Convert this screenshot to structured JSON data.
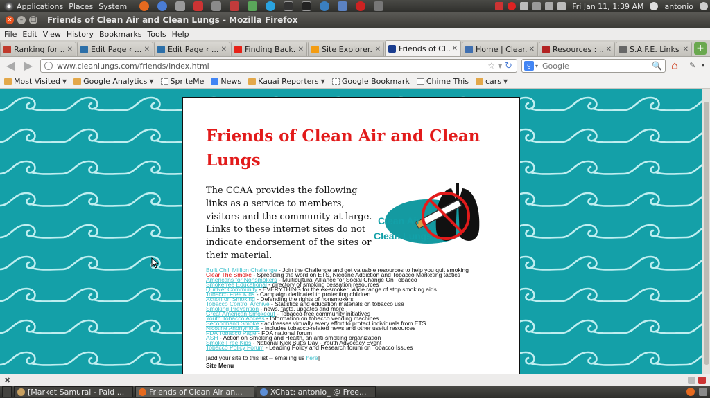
{
  "top_panel": {
    "menus": [
      "Applications",
      "Places",
      "System"
    ],
    "clock": "Fri Jan 11,  1:39 AM",
    "user": "antonio"
  },
  "window": {
    "title": "Friends of Clean Air and Clean Lungs - Mozilla Firefox"
  },
  "menu_bar": [
    "File",
    "Edit",
    "View",
    "History",
    "Bookmarks",
    "Tools",
    "Help"
  ],
  "tabs": [
    {
      "label": "Ranking for ...",
      "favicon_color": "#c0392b",
      "active": false
    },
    {
      "label": "Edit Page ‹ ...",
      "favicon_color": "#2c6fa8",
      "active": false
    },
    {
      "label": "Edit Page ‹ ...",
      "favicon_color": "#2c6fa8",
      "active": false
    },
    {
      "label": "Finding Back...",
      "favicon_color": "#e62117",
      "active": false
    },
    {
      "label": "Site Explorer...",
      "favicon_color": "#f39c12",
      "active": false
    },
    {
      "label": "Friends of Cl...",
      "favicon_color": "#1a3d8f",
      "active": true
    },
    {
      "label": "Home | Clear...",
      "favicon_color": "#3f6fb0",
      "active": false
    },
    {
      "label": "Resources : ...",
      "favicon_color": "#b22222",
      "active": false
    },
    {
      "label": "S.A.F.E. Links",
      "favicon_color": "#666666",
      "active": false
    }
  ],
  "nav": {
    "url": "www.cleanlungs.com/friends/index.html",
    "search_placeholder": "Google",
    "search_engine": "g"
  },
  "bookmarks": [
    {
      "label": "Most Visited",
      "type": "folder",
      "dropdown": true
    },
    {
      "label": "Google Analytics",
      "type": "folder",
      "dropdown": true
    },
    {
      "label": "SpriteMe",
      "type": "page",
      "dropdown": false
    },
    {
      "label": "News",
      "type": "gnews",
      "dropdown": false
    },
    {
      "label": "Kauai Reporters",
      "type": "folder",
      "dropdown": true
    },
    {
      "label": "Google Bookmark",
      "type": "page",
      "dropdown": false
    },
    {
      "label": "Chime This",
      "type": "page",
      "dropdown": false
    },
    {
      "label": "cars",
      "type": "folder",
      "dropdown": true
    }
  ],
  "page": {
    "title": "Friends of Clean Air and Clean Lungs",
    "intro": "The CCAA provides the following links as a service to members, visitors and the community at-large. Links to these internet sites do not indicate endorsement of the sites or their material.",
    "logo_text_line1": "Clean Air",
    "logo_text_line2": "Clean Lungs",
    "links": [
      {
        "name": "Built Chill Million Challenge",
        "desc": " - Join the Challenge and get valuable resources to help you quit smoking",
        "red": false
      },
      {
        "name": "Clear The Smoke",
        "desc": " - Spreading the word on ETS, Nicotine Addiction and Tobacco Marketing tactics",
        "red": true
      },
      {
        "name": "Americans for Nonsmokers",
        "desc": " - Multicultural Alliance for Social Change On Tobacco",
        "red": false
      },
      {
        "name": "Smokefree Educational",
        "desc": " - directory of smoking cessation resources",
        "red": false
      },
      {
        "name": "QuitNet Community",
        "desc": " - EVERYTHING for the ex-smoker. Wide range of stop smoking aids",
        "red": false
      },
      {
        "name": "Tobacco Free Kids",
        "desc": " - Campaign dedicated to protecting children",
        "red": false
      },
      {
        "name": "Action on Smoking",
        "desc": " - Defending the rights of nonsmokers",
        "red": false
      },
      {
        "name": "Tobacco Control Archive",
        "desc": " - Statistics and education materials on tobacco use",
        "red": false
      },
      {
        "name": "Smoking Prevention",
        "desc": " - news, facts, updates and more",
        "red": false
      },
      {
        "name": "Great American Smokeout",
        "desc": " - Tobacco-free community initiatives",
        "red": false
      },
      {
        "name": "Youth Tobacco Access",
        "desc": " - Information on tobacco vending machines",
        "red": false
      },
      {
        "name": "Secondhand Smoke",
        "desc": " - addresses virtually every effort to protect individuals from ETS",
        "red": false
      },
      {
        "name": "Nicotine Anonymous",
        "desc": " - includes tobacco-related news and other useful resources",
        "red": false
      },
      {
        "name": "FDA Tobacco Page",
        "desc": " - FDA national forum",
        "red": false
      },
      {
        "name": "ASH",
        "desc": " - Action on Smoking and Health, an anti-smoking organization",
        "red": false
      },
      {
        "name": "Smoke Free Kids",
        "desc": " - National Kick Butts Day - Youth Advocacy Event",
        "red": false
      },
      {
        "name": "Tobacco Policy Forum",
        "desc": " - Leading Policy and Research forum on Tobacco Issues",
        "red": false
      }
    ],
    "add_site_prefix": "[add your site to this list -- emailing us ",
    "add_site_link": "here",
    "add_site_suffix": "]",
    "site_menu": "Site Menu"
  },
  "taskbar": [
    {
      "label": "[Market Samurai - Paid ...",
      "icon_color": "#c8a060",
      "active": false
    },
    {
      "label": "Friends of Clean Air an...",
      "icon_color": "#e66a1f",
      "active": true
    },
    {
      "label": "XChat: antonio_ @ Free...",
      "icon_color": "#5d8fd6",
      "active": false
    }
  ],
  "colors": {
    "page_background": "#14a0a8",
    "title_red": "#e21b1b",
    "link_cyan": "#40c0cc"
  }
}
